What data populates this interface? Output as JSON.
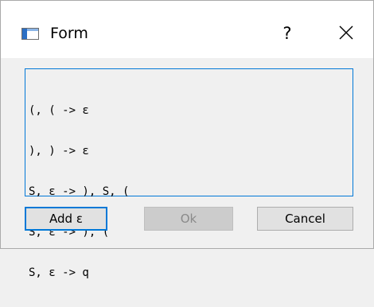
{
  "window": {
    "title": "Form",
    "help_label": "?",
    "close_icon": "close-icon",
    "app_icon": "window-icon"
  },
  "editor": {
    "lines": [
      "(, ( -> ε",
      "), ) -> ε",
      "S, ε -> ), S, (",
      "S, ε -> ), (",
      "S, ε -> q"
    ]
  },
  "buttons": {
    "add_label": "Add ε",
    "ok_label": "Ok",
    "cancel_label": "Cancel"
  },
  "colors": {
    "accent": "#0078d7",
    "disabled_text": "#8a8a8a"
  }
}
